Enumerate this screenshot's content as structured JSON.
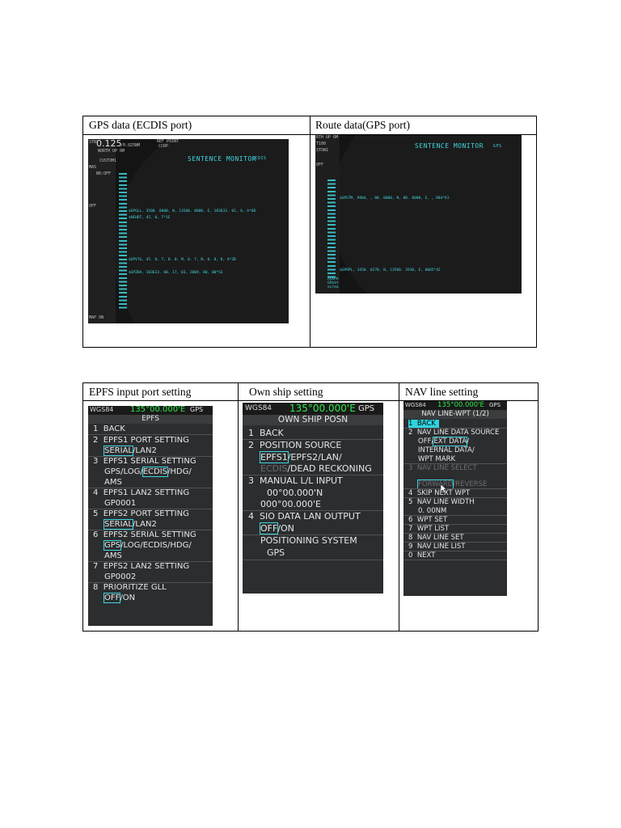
{
  "table1": {
    "headers": [
      "GPS data (ECDIS port)",
      "Route data(GPS port)"
    ],
    "left_shot": {
      "status": [
        "STBY",
        "0.125",
        "/0.025NM",
        "REF POINT",
        "CCRP",
        "NORTH UP RM",
        "CUSTOM1",
        "MAS",
        "BR:OFF",
        "OFF",
        "MAP ON"
      ],
      "title": "SENTENCE MONITOR",
      "title_sub": "ECDIS",
      "lines": [
        "$GPGLL, 3500. 0000, N, 13500. 0000, E, 103633. 01, A, A*6B",
        "$HEHDT, 45. 0, T*1E",
        "$GPVTG, 45. 0, T, 0. 0, M, 0. 7, N, 0. 0, K, A*2B",
        "$GPZDA, 103633. 00, 17, 03, 2009, 00, 00*53"
      ]
    },
    "right_shot": {
      "status": [
        "RTH UP RM",
        "T100",
        "STOW1",
        "OFF"
      ],
      "title": "SENTENCE MONITOR",
      "title_sub": "GPS",
      "lines": [
        "$GPGTM, 9904, , 00. 0000, N, 00. 0000, E, , R84*61",
        "$GPRPL, 3450. 0270, N, 13560. 2930, E, 0005*42"
      ],
      "footer": [
        "ACKPA",
        "GPatt",
        "ecrea"
      ]
    }
  },
  "table2": {
    "headers": [
      "EPFS input port setting",
      "Own ship setting",
      "NAV line setting"
    ],
    "epfs": {
      "top": "WGS84",
      "coord": "135°00.000'E",
      "src": "GPS",
      "title": "EPFS",
      "items": [
        {
          "num": "1",
          "label": "BACK"
        },
        {
          "num": "2",
          "label": "EPFS1 PORT SETTING",
          "opt1": "SERIAL",
          "opt2": "/LAN2"
        },
        {
          "num": "3",
          "label": "EPFS1 SERIAL SETTING",
          "opt_a": "GPS/LOG/",
          "opt_b": "ECDIS",
          "opt_c": "/HDG/",
          "opt_d": "AMS"
        },
        {
          "num": "4",
          "label": "EPFS1 LAN2 SETTING",
          "value": "GP0001"
        },
        {
          "num": "5",
          "label": "EPFS2 PORT SETTING",
          "opt1": "SERIAL",
          "opt2": "/LAN2"
        },
        {
          "num": "6",
          "label": "EPFS2 SERIAL SETTING",
          "opt_a": "GPS",
          "opt_b": "/LOG/ECDIS/HDG/",
          "opt_d": "AMS"
        },
        {
          "num": "7",
          "label": "EPFS2 LAN2 SETTING",
          "value": "GP0002"
        },
        {
          "num": "8",
          "label": "PRIORITIZE GLL",
          "opt1": "OFF",
          "opt2": "/ON"
        }
      ]
    },
    "own": {
      "top": "WGS84",
      "coord": "135°00.000'E",
      "src": "GPS",
      "title": "OWN SHIP POSN",
      "items": [
        {
          "num": "1",
          "label": "BACK"
        },
        {
          "num": "2",
          "label": "POSITION SOURCE",
          "opt1": "EPFS1",
          "opt2": "/EPFS2/LAN/",
          "opt3": "ECDIS",
          "opt4": "/DEAD RECKONING"
        },
        {
          "num": "3",
          "label": "MANUAL L/L INPUT",
          "lat": "00°00.000'N",
          "lon": "000°00.000'E"
        },
        {
          "num": "4",
          "label": "SIO DATA LAN OUTPUT",
          "opt1": "OFF",
          "opt2": "/ON"
        }
      ],
      "pos_sys_label": "POSITIONING SYSTEM",
      "pos_sys_value": "GPS"
    },
    "nav": {
      "top": "WGS84",
      "coord": "135°00.000'E",
      "src": "GPS",
      "title": "NAV LINE-WPT (1/2)",
      "items": [
        {
          "num": "1",
          "label": "BACK"
        },
        {
          "num": "2",
          "label": "NAV LINE DATA SOURCE",
          "opt_a": "OFF/",
          "opt_b": "EXT DATA",
          "opt_c": "/",
          "opt_d": "INTERNAL DATA/",
          "opt_e": "WPT MARK"
        },
        {
          "num": "3",
          "label": "NAV LINE SELECT",
          "opt1": "FORWARD",
          "opt2": "/REVERSE"
        },
        {
          "num": "4",
          "label": "SKIP NEXT WPT"
        },
        {
          "num": "5",
          "label": "NAV LINE WIDTH",
          "value": "0. 00NM"
        },
        {
          "num": "6",
          "label": "WPT SET"
        },
        {
          "num": "7",
          "label": "WPT LIST"
        },
        {
          "num": "8",
          "label": "NAV LINE SET"
        },
        {
          "num": "9",
          "label": "NAV LINE LIST"
        },
        {
          "num": "0",
          "label": "NEXT"
        }
      ]
    }
  },
  "colors": {
    "cyan": "#3fd6e0",
    "green": "#2ee84a",
    "panel": "#2b2d2f",
    "screen": "#141414"
  }
}
